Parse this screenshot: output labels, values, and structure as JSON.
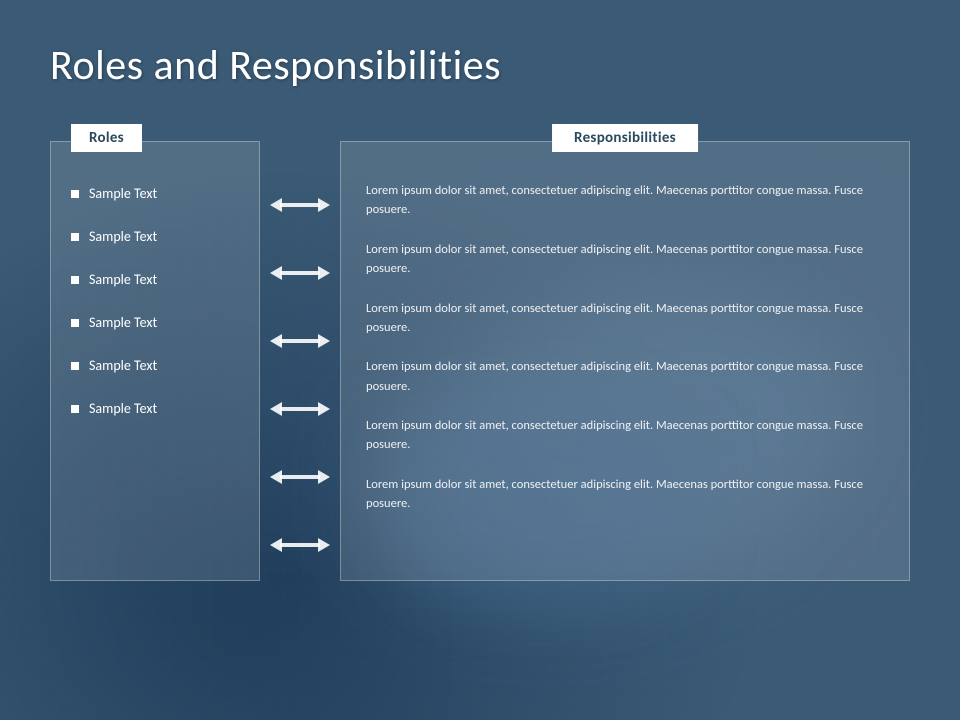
{
  "title": "Roles and Responsibilities",
  "roles_header": "Roles",
  "responsibilities_header": "Responsibilities",
  "roles": [
    {
      "label": "Sample Text"
    },
    {
      "label": "Sample Text"
    },
    {
      "label": "Sample Text"
    },
    {
      "label": "Sample Text"
    },
    {
      "label": "Sample Text"
    },
    {
      "label": "Sample Text"
    }
  ],
  "responsibilities": [
    {
      "text": "Lorem ipsum dolor sit amet, consectetuer adipiscing elit. Maecenas porttitor congue massa. Fusce posuere."
    },
    {
      "text": "Lorem ipsum dolor sit amet, consectetuer adipiscing elit. Maecenas porttitor congue massa. Fusce posuere."
    },
    {
      "text": "Lorem ipsum dolor sit amet, consectetuer adipiscing elit. Maecenas porttitor congue massa. Fusce posuere."
    },
    {
      "text": "Lorem ipsum dolor sit amet, consectetuer adipiscing elit. Maecenas porttitor congue massa. Fusce posuere."
    },
    {
      "text": "Lorem ipsum dolor sit amet, consectetuer adipiscing elit. Maecenas porttitor congue massa. Fusce posuere."
    },
    {
      "text": "Lorem ipsum dolor sit amet, consectetuer adipiscing elit. Maecenas porttitor congue massa. Fusce posuere."
    }
  ]
}
